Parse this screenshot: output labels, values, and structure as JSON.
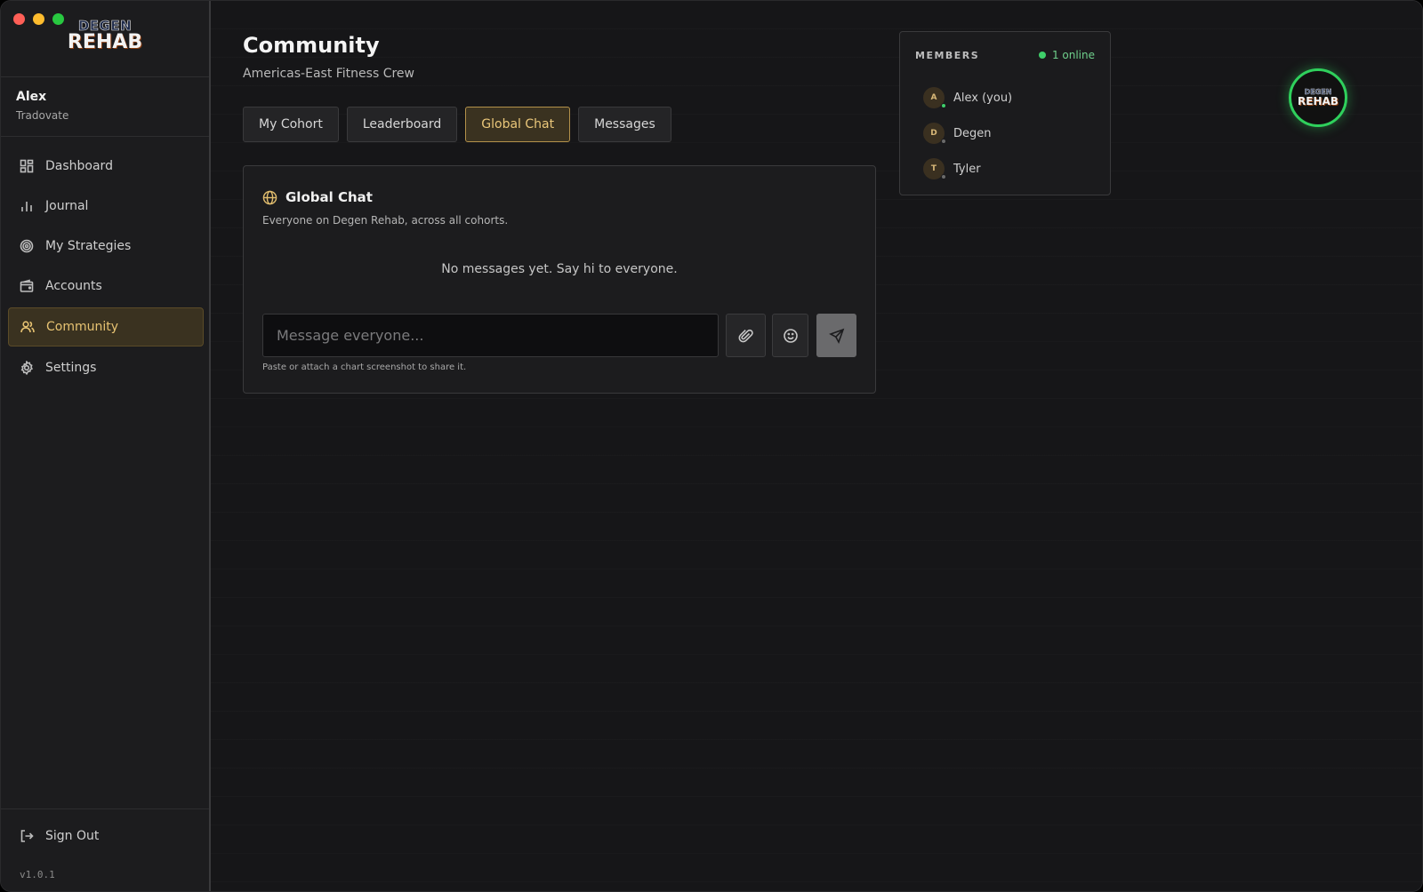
{
  "app": {
    "logo_top": "DEGEN",
    "logo_bottom": "REHAB",
    "version": "v1.0.1"
  },
  "user": {
    "name": "Alex",
    "broker": "Tradovate"
  },
  "sidebar": {
    "items": [
      {
        "label": "Dashboard",
        "icon": "dashboard-icon",
        "active": false
      },
      {
        "label": "Journal",
        "icon": "bar-chart-icon",
        "active": false
      },
      {
        "label": "My Strategies",
        "icon": "target-icon",
        "active": false
      },
      {
        "label": "Accounts",
        "icon": "wallet-icon",
        "active": false
      },
      {
        "label": "Community",
        "icon": "users-icon",
        "active": true
      },
      {
        "label": "Settings",
        "icon": "gear-icon",
        "active": false
      }
    ],
    "signout_label": "Sign Out"
  },
  "header": {
    "title": "Community",
    "subtitle": "Americas-East Fitness Crew"
  },
  "tabs": [
    {
      "label": "My Cohort",
      "active": false
    },
    {
      "label": "Leaderboard",
      "active": false
    },
    {
      "label": "Global Chat",
      "active": true
    },
    {
      "label": "Messages",
      "active": false
    }
  ],
  "chat": {
    "title": "Global Chat",
    "description": "Everyone on Degen Rehab, across all cohorts.",
    "empty_text": "No messages yet. Say hi to everyone.",
    "input_placeholder": "Message everyone...",
    "input_value": "",
    "hint": "Paste or attach a chart screenshot to share it."
  },
  "members": {
    "label": "MEMBERS",
    "online_text": "1 online",
    "list": [
      {
        "initial": "A",
        "name": "Alex (you)",
        "online": true
      },
      {
        "initial": "D",
        "name": "Degen",
        "online": false
      },
      {
        "initial": "T",
        "name": "Tyler",
        "online": false
      }
    ]
  },
  "badge": {
    "top": "DEGEN",
    "bottom": "REHAB"
  },
  "colors": {
    "accent": "#e7c372",
    "active_bg": "#3a3220",
    "online": "#3fcf6a",
    "offline": "#6a6a6a",
    "badge_ring": "#2fd05c"
  }
}
